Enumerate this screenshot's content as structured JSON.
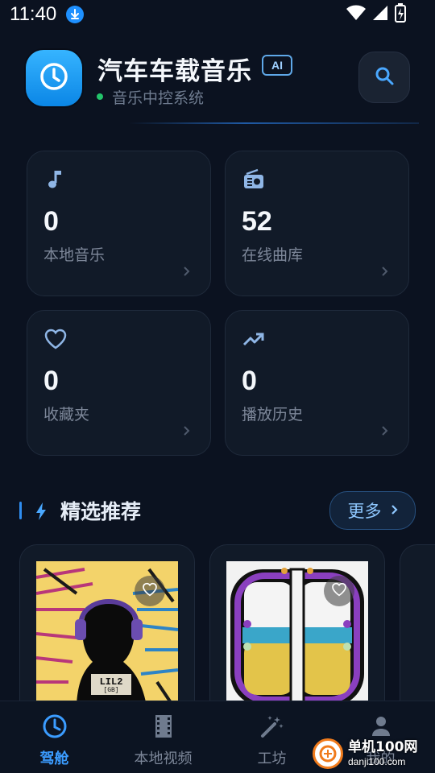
{
  "status_bar": {
    "time": "11:40"
  },
  "header": {
    "title": "汽车车载音乐",
    "badge": "AI",
    "subtitle": "音乐中控系统"
  },
  "stats": [
    {
      "value": "0",
      "label": "本地音乐",
      "icon": "music-note-icon"
    },
    {
      "value": "52",
      "label": "在线曲库",
      "icon": "radio-icon"
    },
    {
      "value": "0",
      "label": "收藏夹",
      "icon": "heart-icon"
    },
    {
      "value": "0",
      "label": "播放历史",
      "icon": "trending-up-icon"
    }
  ],
  "featured": {
    "title": "精选推荐",
    "more_label": "更多",
    "items": [
      {
        "art_text": "LIL2",
        "art_subtext": "[GB]",
        "icon": "heart-icon"
      },
      {
        "icon": "heart-icon"
      }
    ]
  },
  "nav": {
    "items": [
      {
        "label": "驾舱",
        "icon": "clock-icon",
        "active": true
      },
      {
        "label": "本地视频",
        "icon": "film-icon",
        "active": false
      },
      {
        "label": "工坊",
        "icon": "magic-wand-icon",
        "active": false
      },
      {
        "label": "我的",
        "icon": "user-icon",
        "active": false
      }
    ]
  },
  "watermark": {
    "line1": "单机100网",
    "line2": "danji100.com"
  },
  "colors": {
    "background": "#0b1220",
    "accent": "#2f8df0",
    "card": "#111a28",
    "online_dot": "#23c46b"
  }
}
